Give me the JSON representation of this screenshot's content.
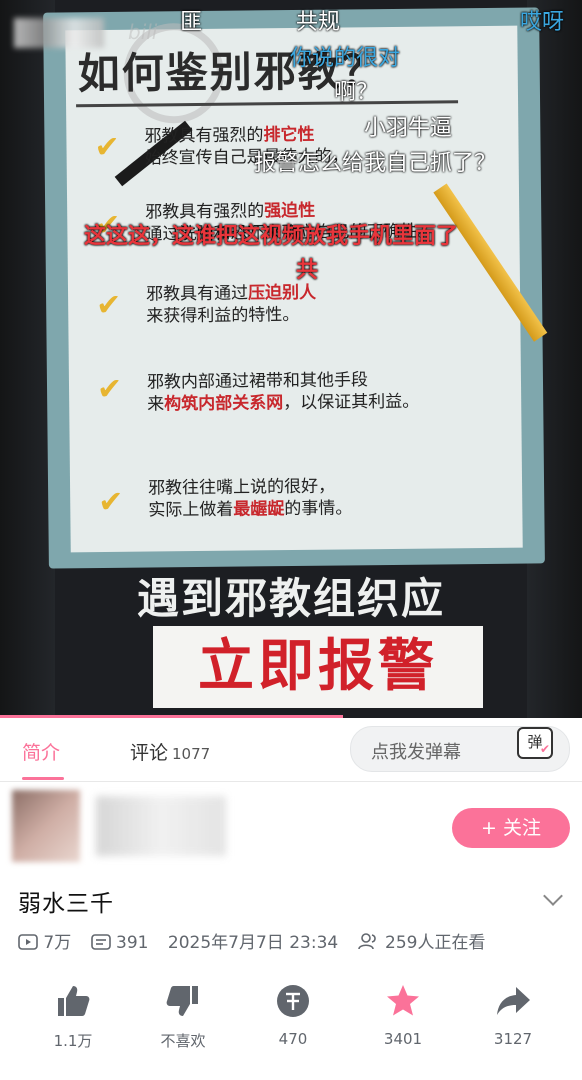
{
  "video": {
    "poster_title": "如何鉴别邪教？",
    "items": [
      {
        "line1_a": "邪教具有强烈的",
        "line1_red": "排它性",
        "line2": "始终宣传自己是最伟大的，"
      },
      {
        "line1_a": "邪教具有强烈的",
        "line1_red": "强迫性",
        "line2": "通过洗脑和恐吓来确立自己的正确性。"
      },
      {
        "line1_a": "邪教具有通过",
        "line1_red": "压迫别人",
        "line2": "来获得利益的特性。"
      },
      {
        "line1_a": "邪教内部通过裙带和其他手段",
        "line1_red": "",
        "line2_a": "来",
        "line2_red": "构筑内部关系网",
        "line2_b": "，以保证其利益。"
      },
      {
        "line1_a": "邪教往往嘴上说的很好，",
        "line1_red": "",
        "line2_a": "实际上做着",
        "line2_red": "最龌龊",
        "line2_b": "的事情。"
      }
    ],
    "caption_line1": "遇到邪教组织应",
    "caption_line2": "立即报警",
    "watermark": "bili",
    "danmaku": [
      {
        "text": "匪",
        "color": "#ffffff"
      },
      {
        "text": "共规",
        "color": "#ffffff"
      },
      {
        "text": "哎呀",
        "color": "#3aa7e0"
      },
      {
        "text": "你说的很对",
        "color": "#3aa7e0"
      },
      {
        "text": "啊？",
        "color": "#ffffff"
      },
      {
        "text": "小羽牛逼",
        "color": "#ffffff"
      },
      {
        "text": "报警怎么给我自己抓了？",
        "color": "#ffffff"
      },
      {
        "text": "这这这，这谁把这视频放我手机里面了",
        "color": "#e8353b"
      },
      {
        "text": "共",
        "color": "#e8353b"
      }
    ],
    "progress": 0.59
  },
  "tabs": {
    "intro": "简介",
    "comments": "评论",
    "comments_count": "1077"
  },
  "danmaku_input": {
    "placeholder": "点我发弹幕",
    "button_label": "弹"
  },
  "uploader": {
    "follow_label": "+ 关注"
  },
  "video_info": {
    "title": "弱水三千",
    "views": "7万",
    "danmaku_count": "391",
    "publish_time": "2025年7月7日 23:34",
    "watching": "259人正在看"
  },
  "actions": {
    "like": "1.1万",
    "dislike": "不喜欢",
    "coin": "470",
    "favorite": "3401",
    "share": "3127"
  }
}
